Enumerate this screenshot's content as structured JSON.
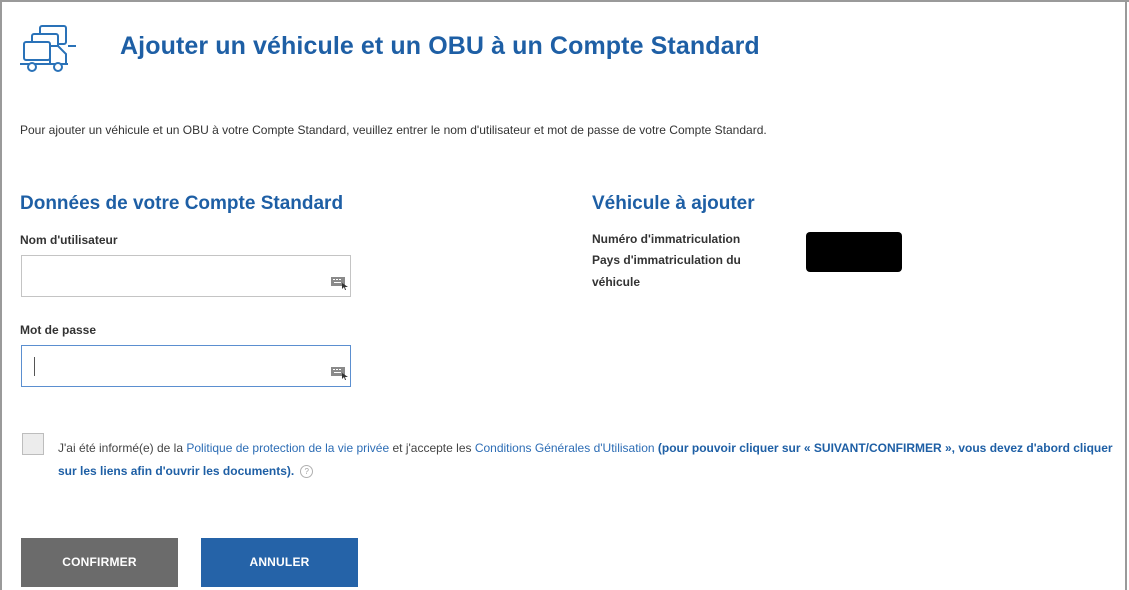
{
  "header": {
    "title": "Ajouter un véhicule et un OBU à un Compte Standard",
    "icon": "truck-fleet-icon"
  },
  "intro_text": "Pour ajouter un véhicule et un OBU à votre Compte Standard, veuillez entrer le nom d'utilisateur et mot de passe de votre Compte Standard.",
  "account_section": {
    "title": "Données de votre Compte Standard",
    "username_label": "Nom d'utilisateur",
    "username_value": "",
    "password_label": "Mot de passe",
    "password_value": ""
  },
  "vehicle_section": {
    "title": "Véhicule à ajouter",
    "plate_label": "Numéro d'immatriculation",
    "country_label_line1": "Pays d'immatriculation du",
    "country_label_line2": "véhicule"
  },
  "consent": {
    "text_1": "J'ai été informé(e) de la ",
    "privacy_link": "Politique de protection de la vie privée",
    "text_2": " et j'accepte les ",
    "terms_link": "Conditions Générales d'Utilisation",
    "note": " (pour pouvoir cliquer sur « SUIVANT/CONFIRMER », vous devez d'abord cliquer sur les liens afin d'ouvrir les documents).",
    "help_symbol": "?"
  },
  "buttons": {
    "confirm": "CONFIRMER",
    "cancel": "ANNULER"
  },
  "colors": {
    "accent": "#1e5fa5",
    "confirm_bg": "#6b6b6b",
    "cancel_bg": "#2563a8"
  }
}
